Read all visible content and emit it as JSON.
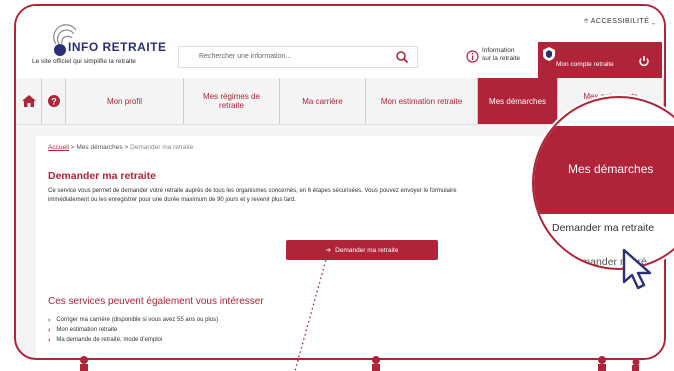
{
  "header": {
    "logo_text": "INFO RETRAITE",
    "tagline": "Le site officiel qui simplifie la retraite",
    "search_placeholder": "Rechercher une information...",
    "info_line1": "Information",
    "info_line2": "sur la retraite",
    "account_label": "Mon compte retraite",
    "accessibility": "ACCESSIBILITÉ"
  },
  "nav": {
    "items": [
      {
        "label": "Mon profil"
      },
      {
        "label": "Mes régimes de retraite"
      },
      {
        "label": "Ma carrière"
      },
      {
        "label": "Mon estimation retraite"
      },
      {
        "label": "Mes démarches"
      },
      {
        "label": "Mes paiements retraite"
      }
    ]
  },
  "breadcrumb": {
    "home": "Accueil",
    "section": "Mes démarches",
    "current": "Demander ma retraite"
  },
  "main": {
    "title": "Demander ma retraite",
    "intro_line1": "Ce service vous permet de demander votre retraite auprès de tous les organismes concernés, en 6 étapes sécurisées. Vous pouvez envoyer le formulaire",
    "intro_line2": "immédiatement ou les enregistrer pour une durée maximum de 90 jours et y revenir plus tard.",
    "cta_label": "Demander ma retraite"
  },
  "also": {
    "title": "Ces services peuvent également vous intéresser",
    "items": [
      {
        "label": "Corriger ma carrière (disponible si vous avez 55 ans ou plus)"
      },
      {
        "label": "Mon estimation retraite"
      },
      {
        "label": "Ma demande de retraite, mode d'emploi"
      }
    ]
  },
  "magnifier": {
    "title": "Mes démarches",
    "item1": "Demander ma retraite",
    "item2": "Demander ma ré"
  },
  "colors": {
    "brand": "#b0243a",
    "logo": "#2c2f77"
  }
}
